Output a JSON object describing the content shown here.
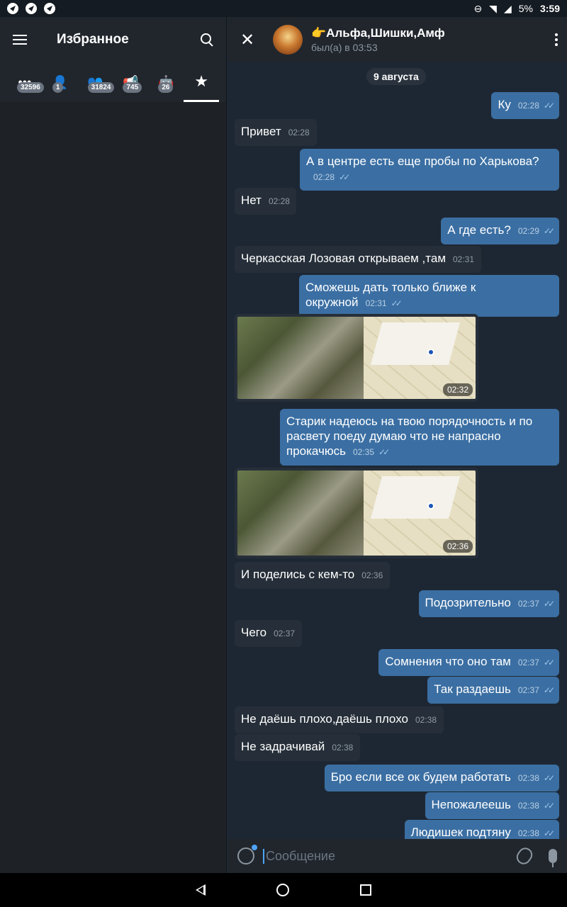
{
  "status_bar": {
    "battery": "5%",
    "time": "3:59"
  },
  "left": {
    "title": "Избранное",
    "folders": [
      {
        "icon": "all-chats-icon",
        "glyph": "•••",
        "count": "32596"
      },
      {
        "icon": "user-icon",
        "glyph": "👤",
        "count": "1"
      },
      {
        "icon": "groups-icon",
        "glyph": "👥",
        "count": "31824"
      },
      {
        "icon": "channels-icon",
        "glyph": "📢",
        "count": "745"
      },
      {
        "icon": "bots-icon",
        "glyph": "🤖",
        "count": "26"
      },
      {
        "icon": "star-icon",
        "glyph": "★",
        "count": ""
      }
    ]
  },
  "chat": {
    "title_emoji": "👉",
    "title": "Альфа,Шишки,Амф",
    "subtitle": "был(а) в 03:53",
    "date": "9 августа",
    "input_placeholder": "Сообщение"
  },
  "messages": [
    {
      "dir": "out",
      "text": "Ку",
      "time": "02:28"
    },
    {
      "dir": "in",
      "text": "Привет",
      "time": "02:28"
    },
    {
      "dir": "out",
      "text": "А в центре есть еще пробы по Харькова?",
      "time": "02:28"
    },
    {
      "dir": "in",
      "text": "Нет",
      "time": "02:28"
    },
    {
      "dir": "out",
      "text": "А где есть?",
      "time": "02:29"
    },
    {
      "dir": "in",
      "text": "Черкасская Лозовая открываем ,там",
      "time": "02:31"
    },
    {
      "dir": "out",
      "text": "Сможешь дать только ближе к окружной",
      "time": "02:31"
    },
    {
      "dir": "in",
      "type": "photo",
      "time": "02:32"
    },
    {
      "dir": "out",
      "text": "Старик надеюсь на твою порядочность и по расвету поеду думаю что не напрасно прокачюсь",
      "time": "02:35"
    },
    {
      "dir": "in",
      "type": "photo",
      "time": "02:36"
    },
    {
      "dir": "in",
      "text": "И поделись с кем-то",
      "time": "02:36"
    },
    {
      "dir": "out",
      "text": "Подозрительно",
      "time": "02:37"
    },
    {
      "dir": "in",
      "text": "Чего",
      "time": "02:37"
    },
    {
      "dir": "out",
      "text": "Сомнения что оно там",
      "time": "02:37"
    },
    {
      "dir": "out",
      "text": "Так раздаешь",
      "time": "02:37"
    },
    {
      "dir": "in",
      "text": "Не даёшь плохо,даёшь плохо",
      "time": "02:38"
    },
    {
      "dir": "in",
      "text": "Не задрачивай",
      "time": "02:38"
    },
    {
      "dir": "out",
      "text": "Бро если все ок будем работать",
      "time": "02:38"
    },
    {
      "dir": "out",
      "text": "Непожалеешь",
      "time": "02:38"
    },
    {
      "dir": "out",
      "text": "Людишек подтяну",
      "time": "02:38"
    }
  ]
}
